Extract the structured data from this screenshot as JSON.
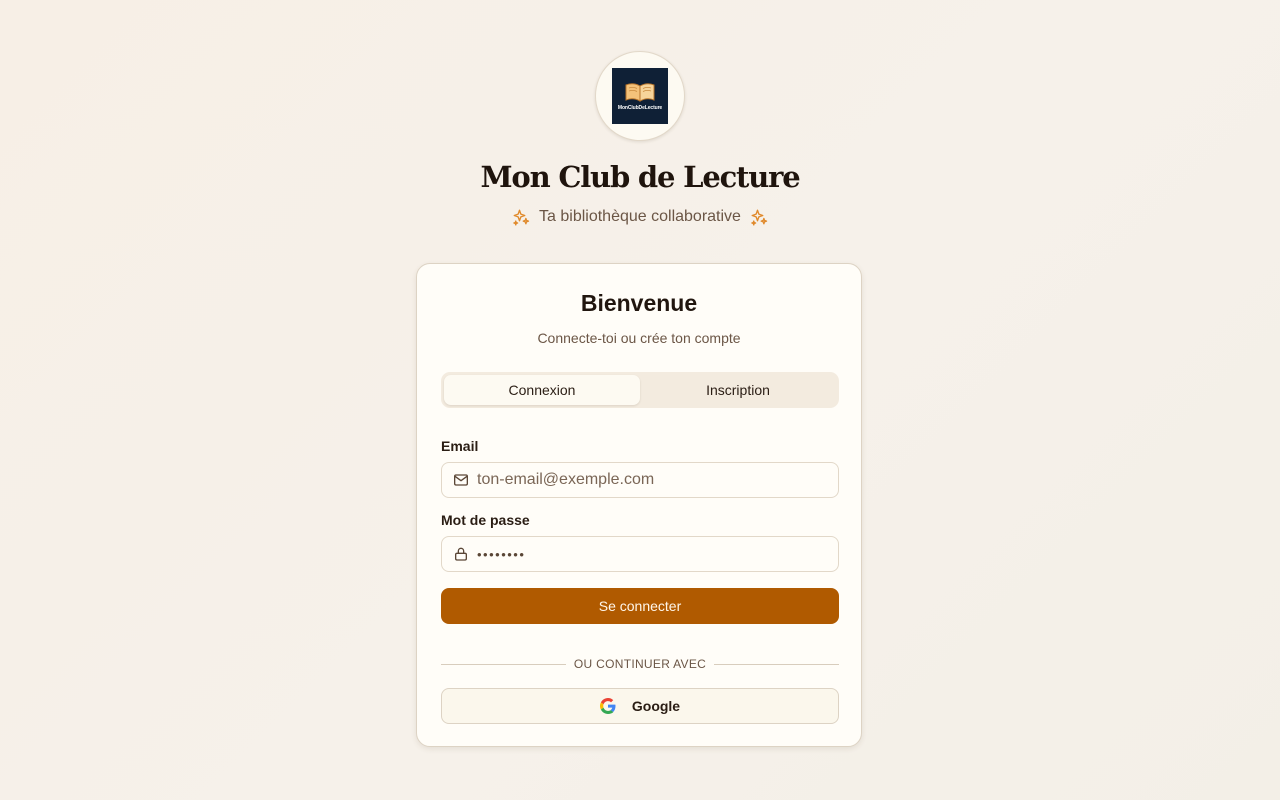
{
  "logo": {
    "text": "MonClubDeLecture",
    "tile_color": "#0f2036",
    "icon": "open-book-icon"
  },
  "app_title": "Mon Club de Lecture",
  "tagline": {
    "text": "Ta bibliothèque collaborative",
    "icon": "sparkles-icon",
    "icon_color": "#e08a2c"
  },
  "card": {
    "title": "Bienvenue",
    "subtitle": "Connecte-toi ou crée ton compte",
    "tabs": [
      {
        "label": "Connexion",
        "active": true
      },
      {
        "label": "Inscription",
        "active": false
      }
    ],
    "email": {
      "label": "Email",
      "placeholder": "ton-email@exemple.com",
      "value": "",
      "icon": "mail-icon"
    },
    "password": {
      "label": "Mot de passe",
      "placeholder": "••••••••",
      "value": "",
      "icon": "lock-icon"
    },
    "submit_label": "Se connecter",
    "divider_text": "OU CONTINUER AVEC",
    "google_label": "Google"
  },
  "colors": {
    "accent": "#b05a00",
    "background": "#f6f0e8",
    "card": "#fffdf8"
  }
}
